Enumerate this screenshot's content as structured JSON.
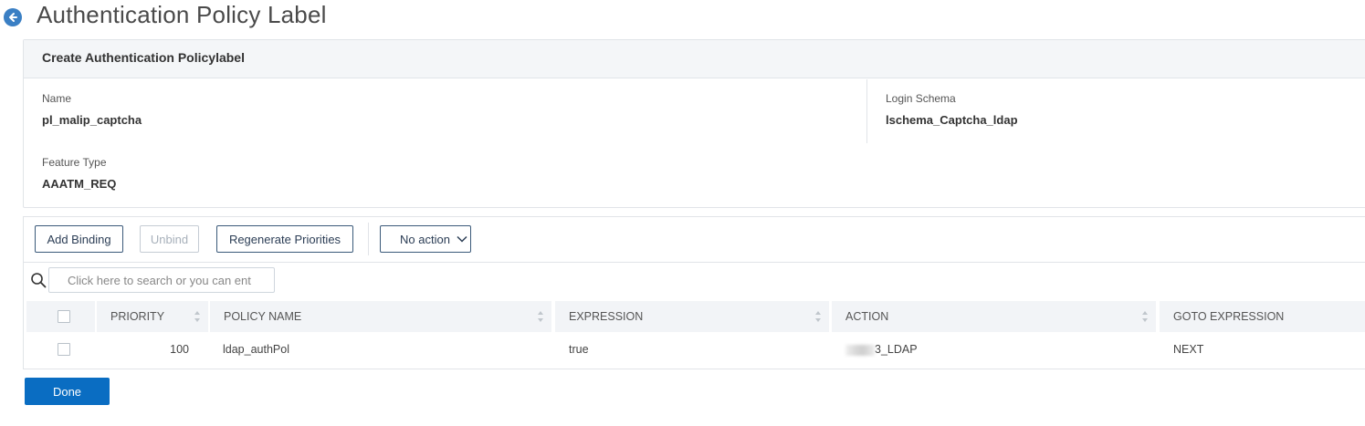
{
  "page": {
    "title": "Authentication Policy Label",
    "back_icon": "arrow-left-circle-icon"
  },
  "form": {
    "header": "Create Authentication Policylabel",
    "name_label": "Name",
    "name_value": "pl_malip_captcha",
    "login_schema_label": "Login Schema",
    "login_schema_value": "lschema_Captcha_ldap",
    "feature_type_label": "Feature Type",
    "feature_type_value": "AAATM_REQ"
  },
  "toolbar": {
    "add_binding": "Add Binding",
    "unbind": "Unbind",
    "regenerate_priorities": "Regenerate Priorities",
    "action_select": "No action"
  },
  "search": {
    "placeholder": "Click here to search or you can ent"
  },
  "table": {
    "columns": [
      "PRIORITY",
      "POLICY NAME",
      "EXPRESSION",
      "ACTION",
      "GOTO EXPRESSION"
    ],
    "rows": [
      {
        "priority": "100",
        "policy_name": "ldap_authPol",
        "expression": "true",
        "action": "3_LDAP",
        "goto_expression": "NEXT"
      }
    ]
  },
  "footer": {
    "done": "Done"
  },
  "colors": {
    "primary": "#0a6dc2",
    "back_icon": "#3a7fc4",
    "header_bg": "#f4f6f8"
  }
}
